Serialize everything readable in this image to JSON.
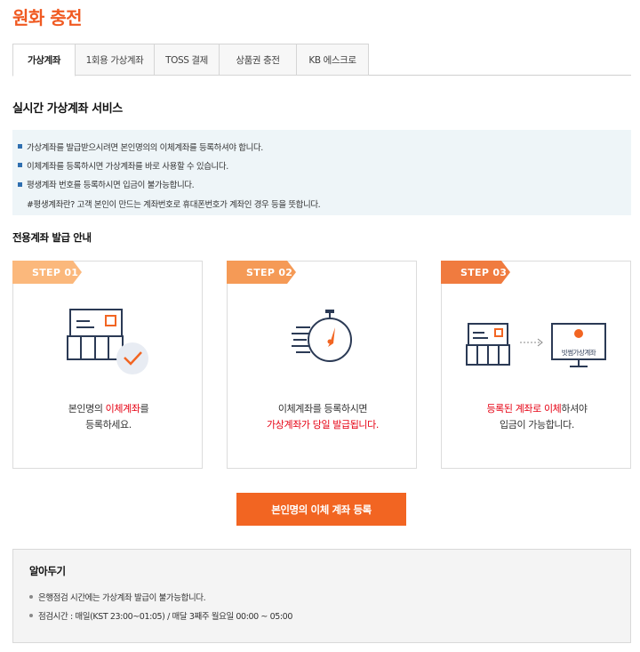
{
  "page": {
    "title": "원화 충전"
  },
  "tabs": [
    {
      "label": "가상계좌",
      "active": true
    },
    {
      "label": "1회용 가상계좌",
      "active": false
    },
    {
      "label": "TOSS 결제",
      "active": false
    },
    {
      "label": "상품권 충전",
      "active": false
    },
    {
      "label": "KB 에스크로",
      "active": false
    }
  ],
  "service": {
    "title": "실시간 가상계좌 서비스",
    "lines": [
      "가상계좌를 발급받으시려면 본인명의의 이체계좌를 등록하셔야 합니다.",
      "이체계좌를 등록하시면 가상계좌를 바로 사용할 수 있습니다.",
      "평생계좌 번호를 등록하시면 입금이 불가능합니다."
    ],
    "note": "#평생계좌란? 고객 본인이 만드는 계좌번호로 휴대폰번호가 계좌인 경우 등을 뜻합니다."
  },
  "guide": {
    "title": "전용계좌 발급 안내",
    "steps": [
      {
        "label": "STEP 01",
        "color": "#fbb87c",
        "icon": "bank-check-icon",
        "line1_pre": "본인명의 ",
        "line1_hl": "이체계좌",
        "line1_post": "를",
        "line2": "등록하세요."
      },
      {
        "label": "STEP 02",
        "color": "#f59a56",
        "icon": "stopwatch-icon",
        "line1": "이체계좌를 등록하시면",
        "line2_hl": "가상계좌가 당일 발급됩니다."
      },
      {
        "label": "STEP 03",
        "color": "#f07b3f",
        "icon": "bank-to-monitor-icon",
        "monitor_label": "빗썸가상계좌",
        "line1_hl1": "등록된 계좌로 이체",
        "line1_post": "하셔야",
        "line2": "입금이 가능합니다."
      }
    ]
  },
  "cta": {
    "label": "본인명의 이체 계좌 등록"
  },
  "notice": {
    "title": "알아두기",
    "items": [
      "은행점검 시간에는 가상계좌 발급이 불가능합니다.",
      "점검시간 : 매일(KST 23:00~01:05) / 매달 3째주 월요일 00:00 ~ 05:00"
    ]
  },
  "colors": {
    "accent": "#f05a22",
    "cta": "#f26522",
    "highlight": "#e60012",
    "info_bg": "#eef5f8",
    "bullet": "#2f6fb0"
  }
}
